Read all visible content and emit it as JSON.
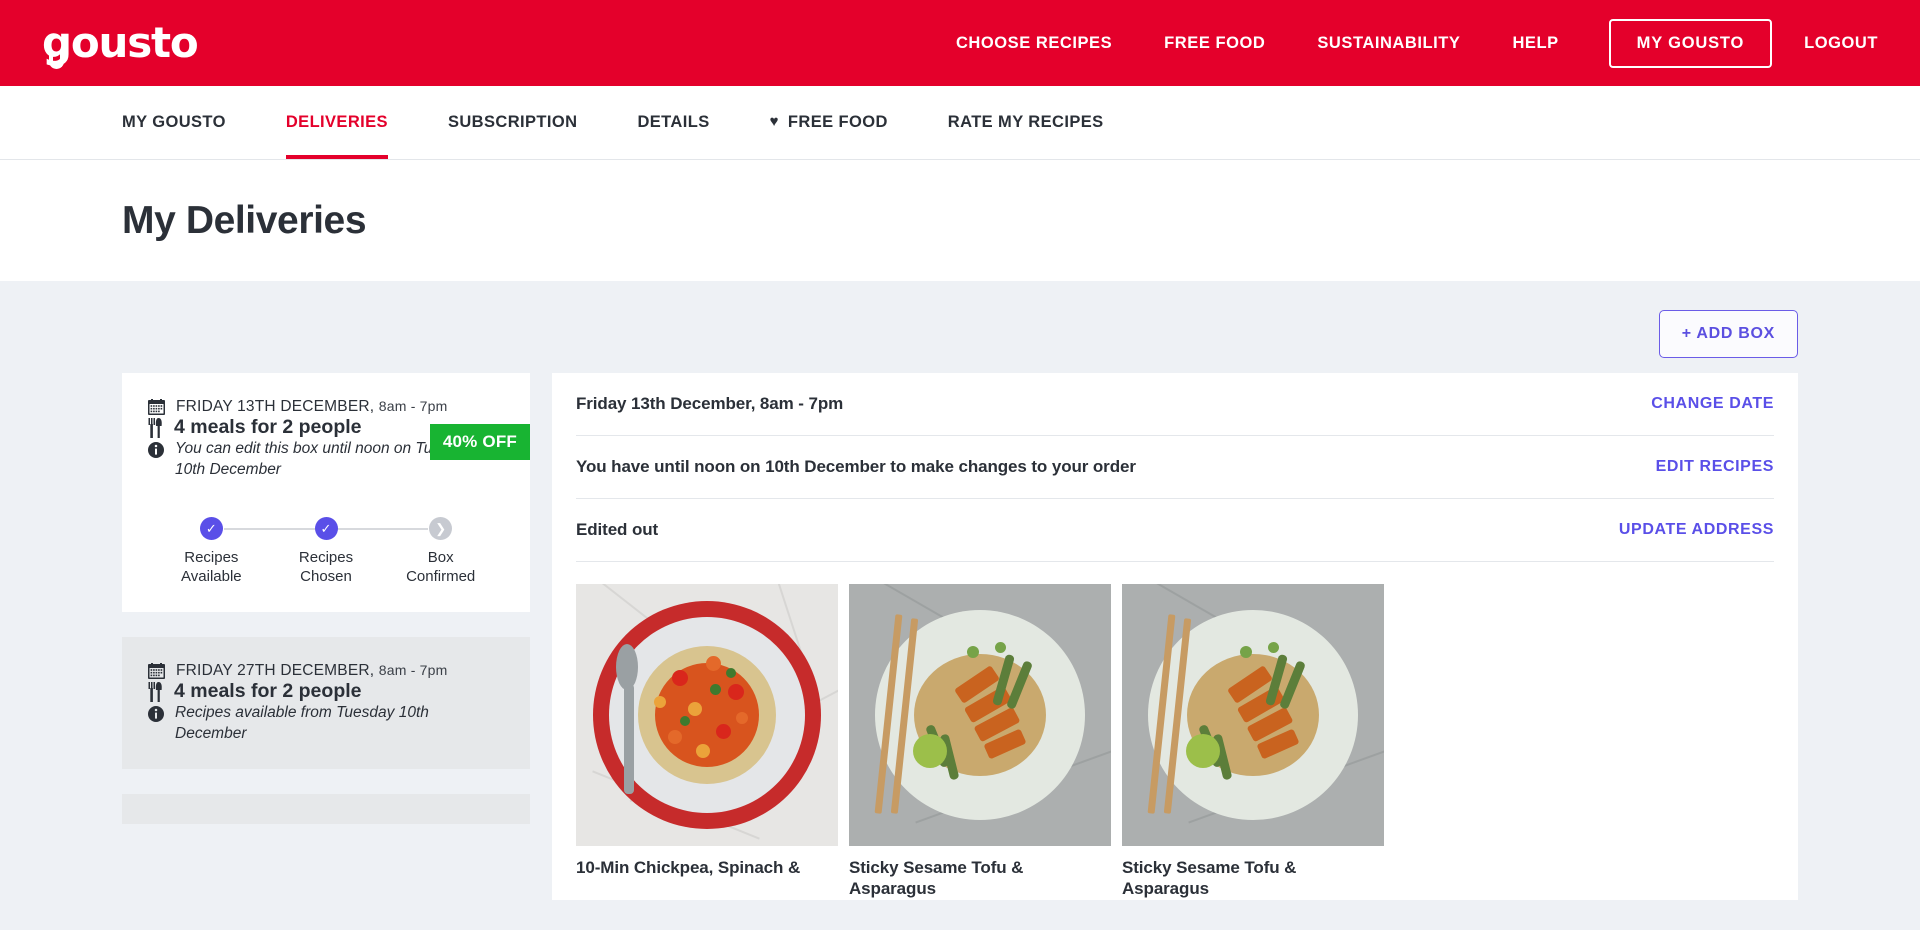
{
  "brand": {
    "logo_text": "gousto",
    "primary_color": "#E4002B",
    "accent_color": "#5A4FE8",
    "badge_color": "#18B432"
  },
  "topnav": {
    "items": [
      {
        "label": "CHOOSE RECIPES"
      },
      {
        "label": "FREE FOOD"
      },
      {
        "label": "SUSTAINABILITY"
      },
      {
        "label": "HELP"
      }
    ],
    "my_gousto_button": "MY GOUSTO",
    "logout": "LOGOUT"
  },
  "subnav": {
    "items": [
      {
        "label": "MY GOUSTO",
        "active": false,
        "icon": ""
      },
      {
        "label": "DELIVERIES",
        "active": true,
        "icon": ""
      },
      {
        "label": "SUBSCRIPTION",
        "active": false,
        "icon": ""
      },
      {
        "label": "DETAILS",
        "active": false,
        "icon": ""
      },
      {
        "label": "FREE FOOD",
        "active": false,
        "icon": "heart-icon"
      },
      {
        "label": "RATE MY RECIPES",
        "active": false,
        "icon": ""
      }
    ]
  },
  "page": {
    "title": "My Deliveries",
    "add_box_label": "+ ADD BOX"
  },
  "deliveries": [
    {
      "date": "FRIDAY 13TH DECEMBER,",
      "slot": "8am - 7pm",
      "meals": "4 meals for 2 people",
      "note": "You can edit this box until noon on Tuesday 10th December",
      "badge": "40% OFF",
      "steps": [
        {
          "label_line1": "Recipes",
          "label_line2": "Available",
          "state": "done"
        },
        {
          "label_line1": "Recipes",
          "label_line2": "Chosen",
          "state": "done"
        },
        {
          "label_line1": "Box",
          "label_line2": "Confirmed",
          "state": "pending"
        }
      ]
    },
    {
      "date": "FRIDAY 27TH DECEMBER,",
      "slot": "8am - 7pm",
      "meals": "4 meals for 2 people",
      "note": "Recipes available from Tuesday 10th December",
      "badge": "",
      "steps": []
    }
  ],
  "detail_panel": {
    "rows": [
      {
        "text": "Friday 13th December, 8am - 7pm",
        "action": "CHANGE DATE"
      },
      {
        "text": "You have until noon on 10th December to make changes to your order",
        "action": "EDIT RECIPES"
      },
      {
        "text": "Edited out",
        "action": "UPDATE ADDRESS"
      }
    ],
    "recipes": [
      {
        "title": "10-Min Chickpea, Spinach &",
        "style": "chickpea"
      },
      {
        "title": "Sticky Sesame Tofu & Asparagus",
        "style": "tofu"
      },
      {
        "title": "Sticky Sesame Tofu & Asparagus",
        "style": "tofu"
      }
    ]
  }
}
